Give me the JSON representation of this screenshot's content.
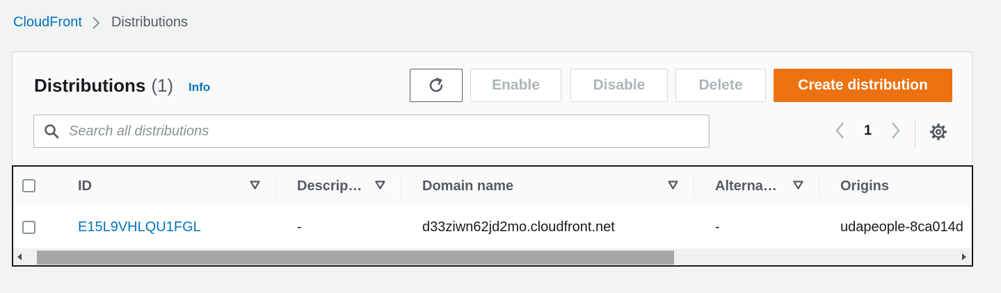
{
  "breadcrumb": {
    "root": "CloudFront",
    "current": "Distributions"
  },
  "header": {
    "title": "Distributions",
    "count": "(1)",
    "info": "Info"
  },
  "toolbar": {
    "refresh_icon": "refresh-icon",
    "enable": "Enable",
    "disable": "Disable",
    "delete": "Delete",
    "create": "Create distribution"
  },
  "search": {
    "placeholder": "Search all distributions",
    "value": ""
  },
  "pagination": {
    "page": "1"
  },
  "table": {
    "columns": [
      "ID",
      "Descrip…",
      "Domain name",
      "Alterna…",
      "Origins"
    ],
    "rows": [
      {
        "id": "E15L9VHLQU1FGL",
        "description": "-",
        "domain": "d33ziwn62jd2mo.cloudfront.net",
        "alternate": "-",
        "origins": "udapeople-8ca014d"
      }
    ]
  },
  "colors": {
    "accent": "#ec7211",
    "link": "#0073bb"
  }
}
